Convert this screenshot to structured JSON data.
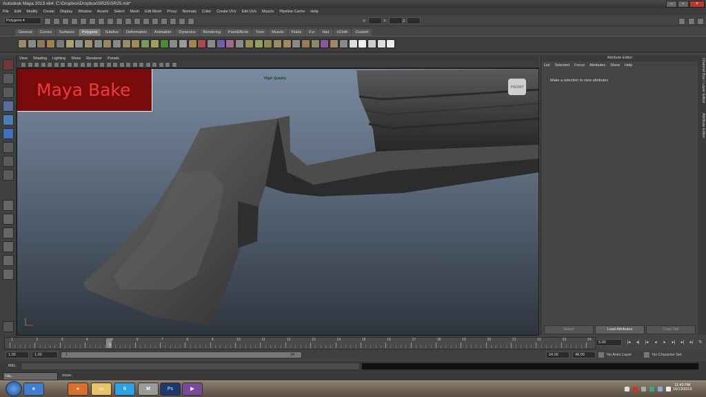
{
  "window": {
    "title": "Autodesk Maya 2013 x64: C:\\Dropbox\\Dropbox\\SR25\\SR25.mb*"
  },
  "menus": [
    "File",
    "Edit",
    "Modify",
    "Create",
    "Display",
    "Window",
    "Assets",
    "Select",
    "Mesh",
    "Edit Mesh",
    "Proxy",
    "Normals",
    "Color",
    "Create UVs",
    "Edit UVs",
    "Muscle",
    "Pipeline Cache",
    "Help"
  ],
  "status_line": {
    "mode": "Polygons",
    "x_label": "X:",
    "y_label": "Y:",
    "z_label": "Z:"
  },
  "shelf_tabs": [
    "General",
    "Curves",
    "Surfaces",
    "Polygons",
    "Subdivs",
    "Deformation",
    "Animation",
    "Dynamics",
    "Rendering",
    "PaintEffects",
    "Toon",
    "Muscle",
    "Fluids",
    "Fur",
    "Hair",
    "nCloth",
    "Custom"
  ],
  "shelf_active": "Polygons",
  "panel_menu": [
    "View",
    "Shading",
    "Lighting",
    "Show",
    "Renderer",
    "Panels"
  ],
  "viewport": {
    "overlay_title": "Maya Bake",
    "quality_label": "High Quality",
    "cube_label": "FRONT",
    "bg_top": "#7a8aa0",
    "bg_bottom": "#2f353f"
  },
  "attribute_editor": {
    "title": "Attribute Editor",
    "menu": [
      "List",
      "Selected",
      "Focus",
      "Attributes",
      "Show",
      "Help"
    ],
    "message": "Make a selection to view attributes",
    "buttons": {
      "select": "Select",
      "load": "Load Attributes",
      "copy": "Copy Tab"
    }
  },
  "side_tabs": {
    "channel_box": "Channel Box / Layer Editor",
    "attr_editor": "Attribute Editor"
  },
  "timeline": {
    "ticks": [
      "1",
      "2",
      "3",
      "4",
      "5",
      "6",
      "7",
      "8",
      "9",
      "10",
      "11",
      "12",
      "13",
      "14",
      "15",
      "16",
      "17",
      "18",
      "19",
      "20",
      "21",
      "22",
      "23",
      "24"
    ],
    "current_frame_label": "5",
    "current_frame": "5.00"
  },
  "range": {
    "start": "1.00",
    "playback_start": "1.00",
    "slider_start": "1",
    "slider_end": "24",
    "playback_end": "24.00",
    "end": "48.00",
    "anim_layer": "No Anim Layer",
    "character_set": "No Character Set"
  },
  "command_line": {
    "label": "MEL"
  },
  "help_line": {
    "text": "move."
  },
  "minimized_window": {
    "label": "Ha..."
  },
  "taskbar": {
    "apps": [
      "ie",
      "firefox",
      "explorer",
      "skype",
      "maya",
      "Ps",
      "media"
    ],
    "time": "11:43 PM",
    "date": "10/13/2013"
  },
  "colors": {
    "banner_bg": "#7a0b0b",
    "banner_text": "#ee3b3b",
    "quality_text": "#0f4d1a"
  }
}
